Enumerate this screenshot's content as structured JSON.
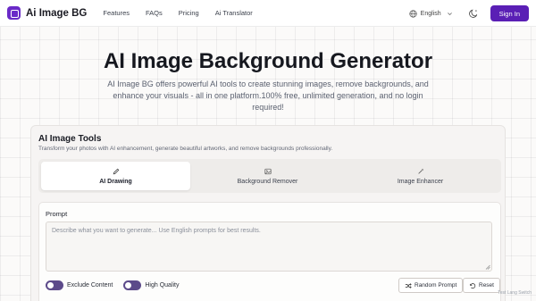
{
  "nav": {
    "brand": "Ai Image BG",
    "links": [
      "Features",
      "FAQs",
      "Pricing",
      "Ai Translator"
    ],
    "language": "English",
    "signin": "Sign In"
  },
  "hero": {
    "title": "AI Image Background Generator",
    "subtitle": "AI Image BG offers powerful AI tools to create stunning images, remove backgrounds, and enhance your visuals - all in one platform.100% free, unlimited generation, and no login required!"
  },
  "tools": {
    "title": "AI Image Tools",
    "description": "Transform your photos with AI enhancement, generate beautiful artworks, and remove backgrounds professionally.",
    "tabs": [
      {
        "label": "AI Drawing",
        "icon": "pencil-icon",
        "active": true
      },
      {
        "label": "Background Remover",
        "icon": "image-icon",
        "active": false
      },
      {
        "label": "Image Enhancer",
        "icon": "wand-icon",
        "active": false
      }
    ],
    "prompt_label": "Prompt",
    "prompt_placeholder": "Describe what you want to generate... Use English prompts for best results.",
    "prompt_value": "",
    "toggles": [
      "Exclude Content",
      "High Quality"
    ],
    "random_button": "Random Prompt",
    "reset_button": "Reset"
  },
  "footer_note": "Test Lang Switch",
  "colors": {
    "brand": "#5a1fb5",
    "toggle": "#5c4a8a"
  }
}
